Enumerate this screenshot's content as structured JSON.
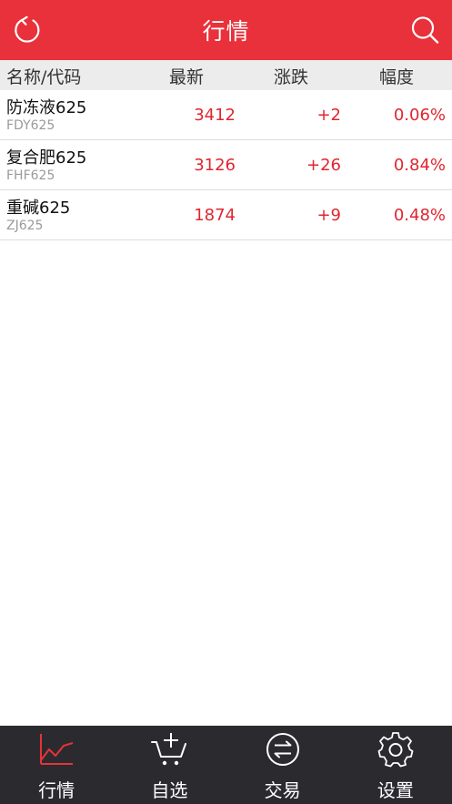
{
  "header": {
    "title": "行情",
    "refresh_icon": "refresh-icon",
    "search_icon": "search-icon"
  },
  "columns": {
    "name": "名称/代码",
    "price": "最新",
    "change": "涨跌",
    "percent": "幅度"
  },
  "rows": [
    {
      "name": "防冻液625",
      "code": "FDY625",
      "price": "3412",
      "change": "+2",
      "percent": "0.06%"
    },
    {
      "name": "复合肥625",
      "code": "FHF625",
      "price": "3126",
      "change": "+26",
      "percent": "0.84%"
    },
    {
      "name": "重碱625",
      "code": "ZJ625",
      "price": "1874",
      "change": "+9",
      "percent": "0.48%"
    }
  ],
  "tabs": [
    {
      "label": "行情",
      "icon": "chart-line-icon",
      "active": true
    },
    {
      "label": "自选",
      "icon": "cart-add-icon",
      "active": false
    },
    {
      "label": "交易",
      "icon": "exchange-icon",
      "active": false
    },
    {
      "label": "设置",
      "icon": "gear-icon",
      "active": false
    }
  ],
  "colors": {
    "brand_red": "#e8313a",
    "up_red": "#e0262f",
    "tabbar_bg": "#2b2b2f",
    "column_header_bg": "#ececec"
  }
}
